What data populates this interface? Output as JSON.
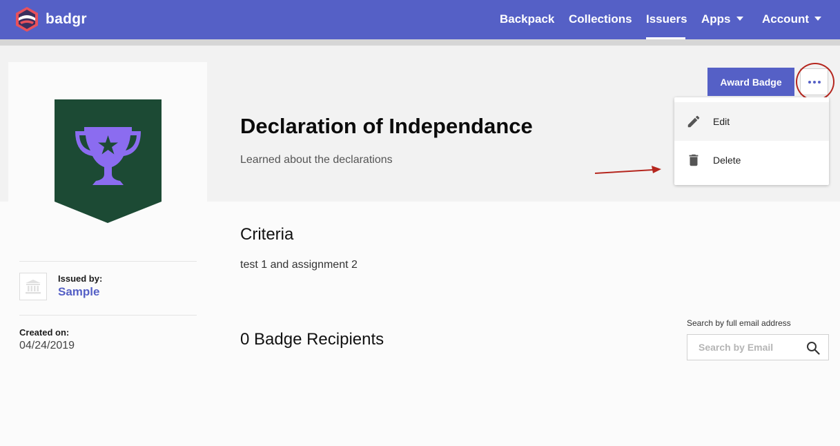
{
  "brand": {
    "name": "badgr"
  },
  "nav": {
    "items": [
      {
        "label": "Backpack"
      },
      {
        "label": "Collections"
      },
      {
        "label": "Issuers"
      },
      {
        "label": "Apps"
      },
      {
        "label": "Account"
      }
    ],
    "active": "Issuers"
  },
  "badge": {
    "title": "Declaration of Independance",
    "description": "Learned about the declarations",
    "colors": {
      "background": "#1c4a34",
      "icon": "#8b6cf0"
    }
  },
  "issuer": {
    "label": "Issued by:",
    "name": "Sample"
  },
  "created": {
    "label": "Created on:",
    "value": "04/24/2019"
  },
  "criteria": {
    "title": "Criteria",
    "text": "test 1 and assignment 2"
  },
  "recipients": {
    "title": "0 Badge Recipients"
  },
  "actions": {
    "award_label": "Award Badge",
    "menu": [
      {
        "label": "Edit",
        "icon": "pencil-icon"
      },
      {
        "label": "Delete",
        "icon": "trash-icon"
      }
    ]
  },
  "search": {
    "label": "Search by full email address",
    "placeholder": "Search by Email",
    "value": ""
  },
  "colors": {
    "accent": "#5560c6",
    "annotation": "#b5261e"
  }
}
